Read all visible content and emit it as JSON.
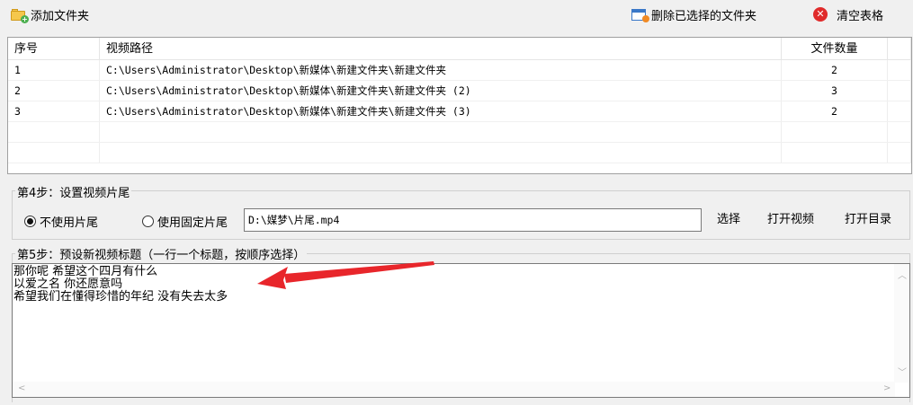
{
  "toolbar": {
    "add_folder_label": "添加文件夹",
    "delete_selected_label": "删除已选择的文件夹",
    "clear_table_label": "清空表格"
  },
  "table": {
    "columns": [
      "序号",
      "视频路径",
      "文件数量"
    ],
    "rows": [
      {
        "index": "1",
        "path": "C:\\Users\\Administrator\\Desktop\\新媒体\\新建文件夹\\新建文件夹",
        "count": "2"
      },
      {
        "index": "2",
        "path": "C:\\Users\\Administrator\\Desktop\\新媒体\\新建文件夹\\新建文件夹 (2)",
        "count": "3"
      },
      {
        "index": "3",
        "path": "C:\\Users\\Administrator\\Desktop\\新媒体\\新建文件夹\\新建文件夹 (3)",
        "count": "2"
      }
    ]
  },
  "step4": {
    "legend": "第4步：设置视频片尾",
    "option_none": "不使用片尾",
    "option_fixed": "使用固定片尾",
    "selected": "none",
    "path_value": "D:\\媒梦\\片尾.mp4",
    "select_button": "选择",
    "open_video_button": "打开视频",
    "open_dir_button": "打开目录"
  },
  "step5": {
    "legend": "第5步：预设新视频标题（一行一个标题，按顺序选择）",
    "titles": "那你呢 希望这个四月有什么\n以爱之名 你还愿意吗\n希望我们在懂得珍惜的年纪 没有失去太多"
  },
  "annotation": {
    "arrow_color": "#e8262b"
  }
}
